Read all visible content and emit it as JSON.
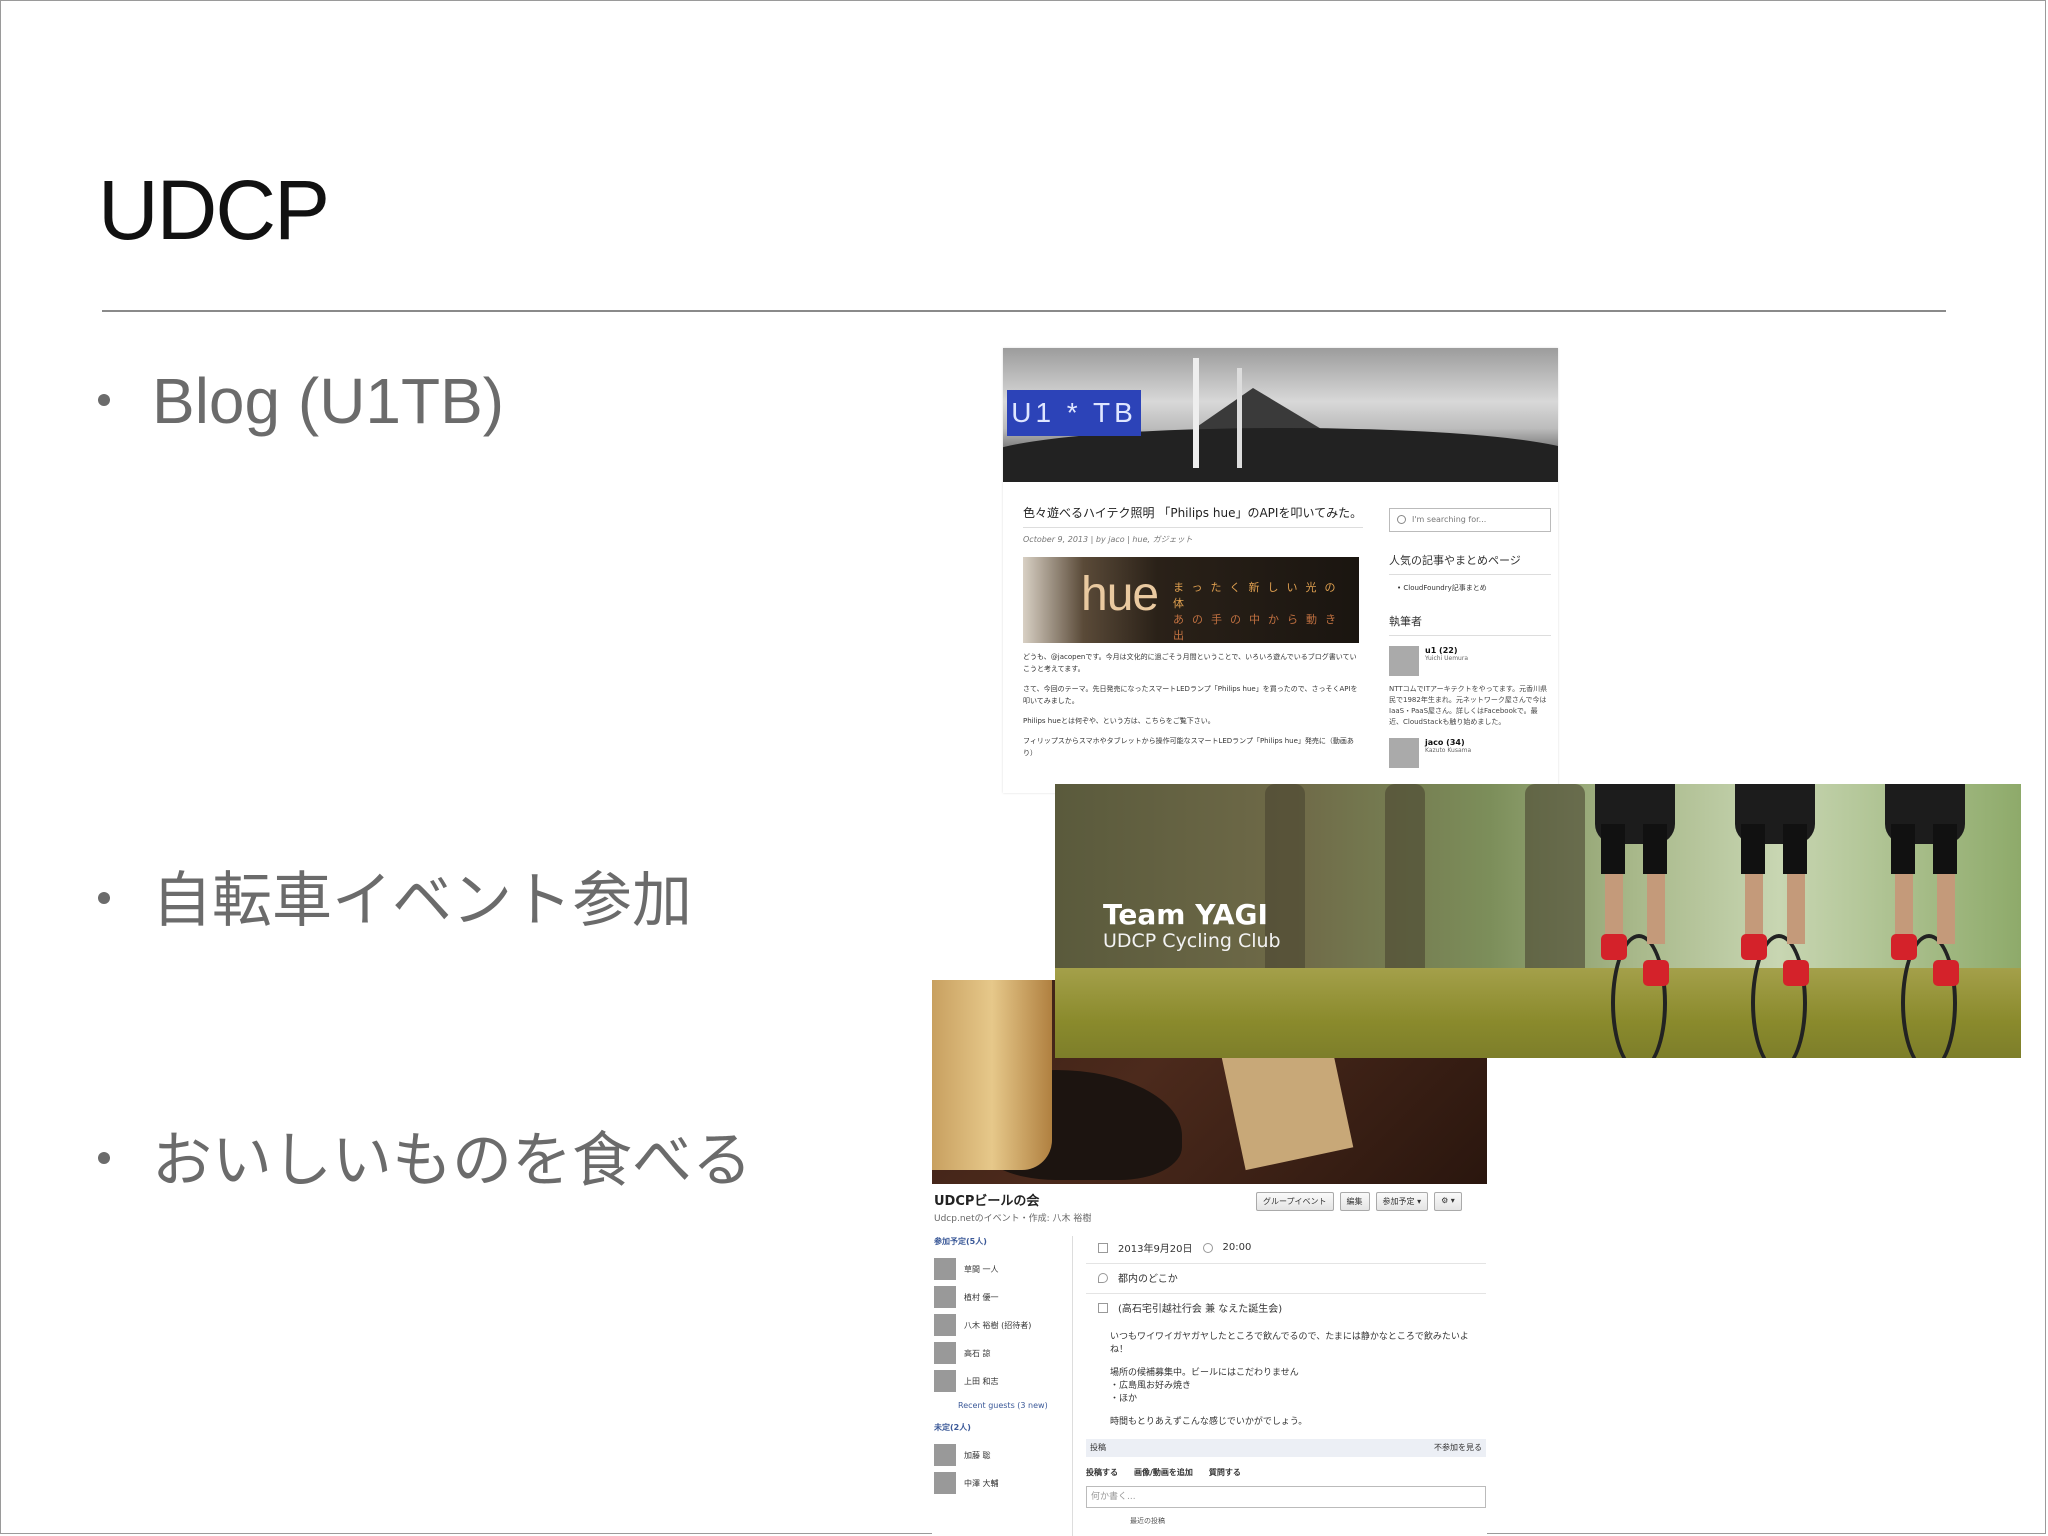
{
  "slide": {
    "title": "UDCP",
    "bullets": [
      "Blog (U1TB)",
      "自転車イベント参加",
      "おいしいものを食べる"
    ]
  },
  "blog": {
    "logo": "U1 * TB",
    "post_title": "色々遊べるハイテク照明 「Philips hue」のAPIを叩いてみた。",
    "meta": "October 9, 2013 | by jaco | hue, ガジェット",
    "hue_word": "hue",
    "hue_tagline_1": "まったく新しい光の体",
    "hue_tagline_2": "あの手の中から動き出",
    "paragraphs": [
      "どうも、@jacopenです。今月は文化的に過ごそう月間ということで、いろいろ遊んでいるブログ書いていこうと考えてます。",
      "さて、今回のテーマ。先日発売になったスマートLEDランプ「Philips hue」を買ったので、さっそくAPIを叩いてみました。",
      "Philips hueとは何ぞや、という方は、こちらをご覧下さい。",
      "フィリップスからスマホやタブレットから操作可能なスマートLEDランプ「Philips hue」発売に（動画あり）"
    ],
    "search_placeholder": "I'm searching for...",
    "sidebar_heading_popular": "人気の記事やまとめページ",
    "sidebar_item": "CloudFoundry記事まとめ",
    "sidebar_heading_authors": "執筆者",
    "author1_name": "u1 (22)",
    "author1_sub": "Yuichi Uemura",
    "author1_desc": "NTTコムでITアーキテクトをやってます。元香川県民で1982年生まれ。元ネットワーク屋さんで今はIaaS・PaaS屋さん。詳しくはFacebookで。最近、CloudStackも触り始めました。",
    "author2_name": "jaco (34)",
    "author2_sub": "Kazuto Kusama"
  },
  "cycling": {
    "title": "Team YAGI",
    "subtitle": "UDCP Cycling Club"
  },
  "fb_event": {
    "title": "UDCPビールの会",
    "subtitle": "Udcp.netのイベント・作成: 八木 裕樹",
    "actions": [
      "グループイベント",
      "編集",
      "参加予定 ▾",
      "⚙ ▾"
    ],
    "going_heading": "参加予定(5人)",
    "going": [
      "草間 一人",
      "植村 優一",
      "八木 裕樹 (招待者)",
      "高石 諒",
      "上田 和志"
    ],
    "recent_guests": "Recent guests (3 new)",
    "maybe_heading": "未定(2人)",
    "maybe": [
      "加藤 聡",
      "中澤 大輔"
    ],
    "date": "2013年9月20日",
    "time": "20:00",
    "place": "都内のどこか",
    "desc_title": "(高石宅引越社行会 兼 なえた誕生会)",
    "desc_lines": [
      "いつもワイワイガヤガヤしたところで飲んでるので、たまには静かなところで飲みたいよね！",
      "場所の候補募集中。ビールにはこだわりません\n・広島風お好み焼き\n・ほか",
      "時間もとりあえずこんな感じでいかがでしょう。"
    ],
    "post_label": "投稿",
    "hide_label": "不参加を見る",
    "post_actions": [
      "投稿する",
      "画像/動画を追加",
      "質問する"
    ],
    "composer_placeholder": "何か書く...",
    "recent_posts": "最近の投稿"
  }
}
